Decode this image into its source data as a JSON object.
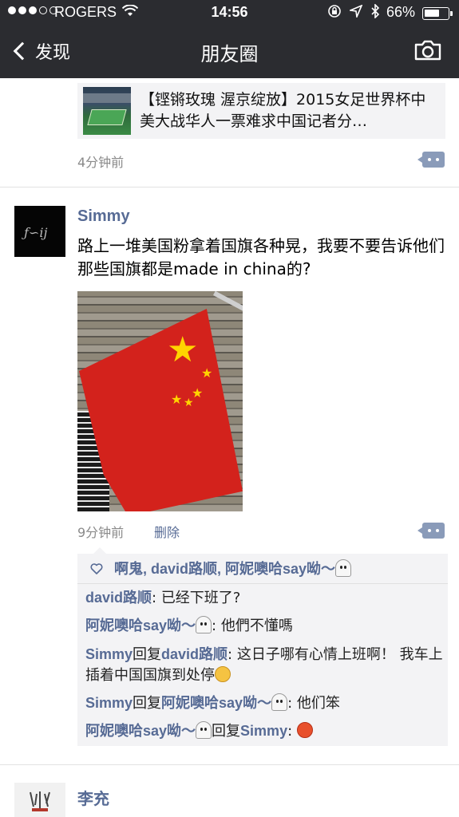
{
  "status_bar": {
    "carrier": "ROGERS",
    "time": "14:56",
    "battery_percent": "66%",
    "battery_level": 0.66,
    "signal_bars_filled": 3,
    "signal_bars_total": 5
  },
  "nav": {
    "back_label": "发现",
    "title": "朋友圈",
    "camera_icon": "camera-icon"
  },
  "previous_post": {
    "link_title": "【铿锵玫瑰 渥京绽放】2015女足世界杯中美大战华人一票难求中国记者分…",
    "time": "4分钟前"
  },
  "post": {
    "author": "Simmy",
    "avatar_text": "ƒ∽ij",
    "text": "路上一堆美国粉拿着国旗各种晃，我要不要告诉他们那些国旗都是made in china的?",
    "time": "9分钟前",
    "delete_label": "删除",
    "likes": "啊鬼, david路顺, 阿妮噢哈say呦～"
  },
  "comments": [
    {
      "from": "david路顺",
      "reply_word": "",
      "to": "",
      "sep": ": ",
      "text": "已经下班了?",
      "emoji": ""
    },
    {
      "from": "阿妮噢哈say呦～",
      "from_ghost": true,
      "reply_word": "",
      "to": "",
      "sep": ": ",
      "text": "他們不懂嗎",
      "emoji": ""
    },
    {
      "from": "Simmy",
      "reply_word": "回复",
      "to": "david路顺",
      "sep": ": ",
      "text": "这日子哪有心情上班啊！ 我车上插着中国国旗到处停",
      "emoji": "think"
    },
    {
      "from": "Simmy",
      "reply_word": "回复",
      "to": "阿妮噢哈say呦～",
      "to_ghost": true,
      "sep": ": ",
      "text": "他们笨",
      "emoji": ""
    },
    {
      "from": "阿妮噢哈say呦～",
      "from_ghost": true,
      "reply_word": "回复",
      "to": "Simmy",
      "sep": ": ",
      "text": "",
      "emoji": "angry"
    }
  ],
  "next_post": {
    "author": "李充"
  },
  "colors": {
    "nav_bg": "#2b2c30",
    "name_blue": "#576b95",
    "time_gray": "#8a8a8a",
    "comment_bg": "#f3f3f5",
    "flag_red": "#d3221c",
    "star_yellow": "#ffd400"
  }
}
